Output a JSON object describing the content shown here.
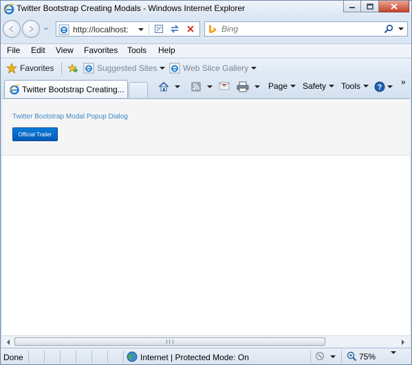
{
  "window": {
    "title": "Twitter Bootstrap Creating Modals - Windows Internet Explorer",
    "minimize_icon": "minimize-icon",
    "maximize_icon": "maximize-icon",
    "close_icon": "close-icon"
  },
  "address": {
    "url": "http://localhost:",
    "search_placeholder": "Bing"
  },
  "menu": [
    "File",
    "Edit",
    "View",
    "Favorites",
    "Tools",
    "Help"
  ],
  "favorites_bar": {
    "favorites_label": "Favorites",
    "suggested_sites": "Suggested Sites",
    "web_slice_gallery": "Web Slice Gallery"
  },
  "tab": {
    "title": "Twitter Bootstrap Creating..."
  },
  "command_bar": {
    "page": "Page",
    "safety": "Safety",
    "tools": "Tools",
    "overflow": "»"
  },
  "page": {
    "heading": "Twitter Bootstrap Modal Popup Dialog",
    "button_label": "Official Trailer"
  },
  "status": {
    "left": "Done",
    "zone": "Internet | Protected Mode: On",
    "zoom": "75%"
  },
  "colors": {
    "link_blue": "#3a87c6",
    "button_blue": "#0866c6",
    "chrome_blue": "#dce7f4"
  }
}
